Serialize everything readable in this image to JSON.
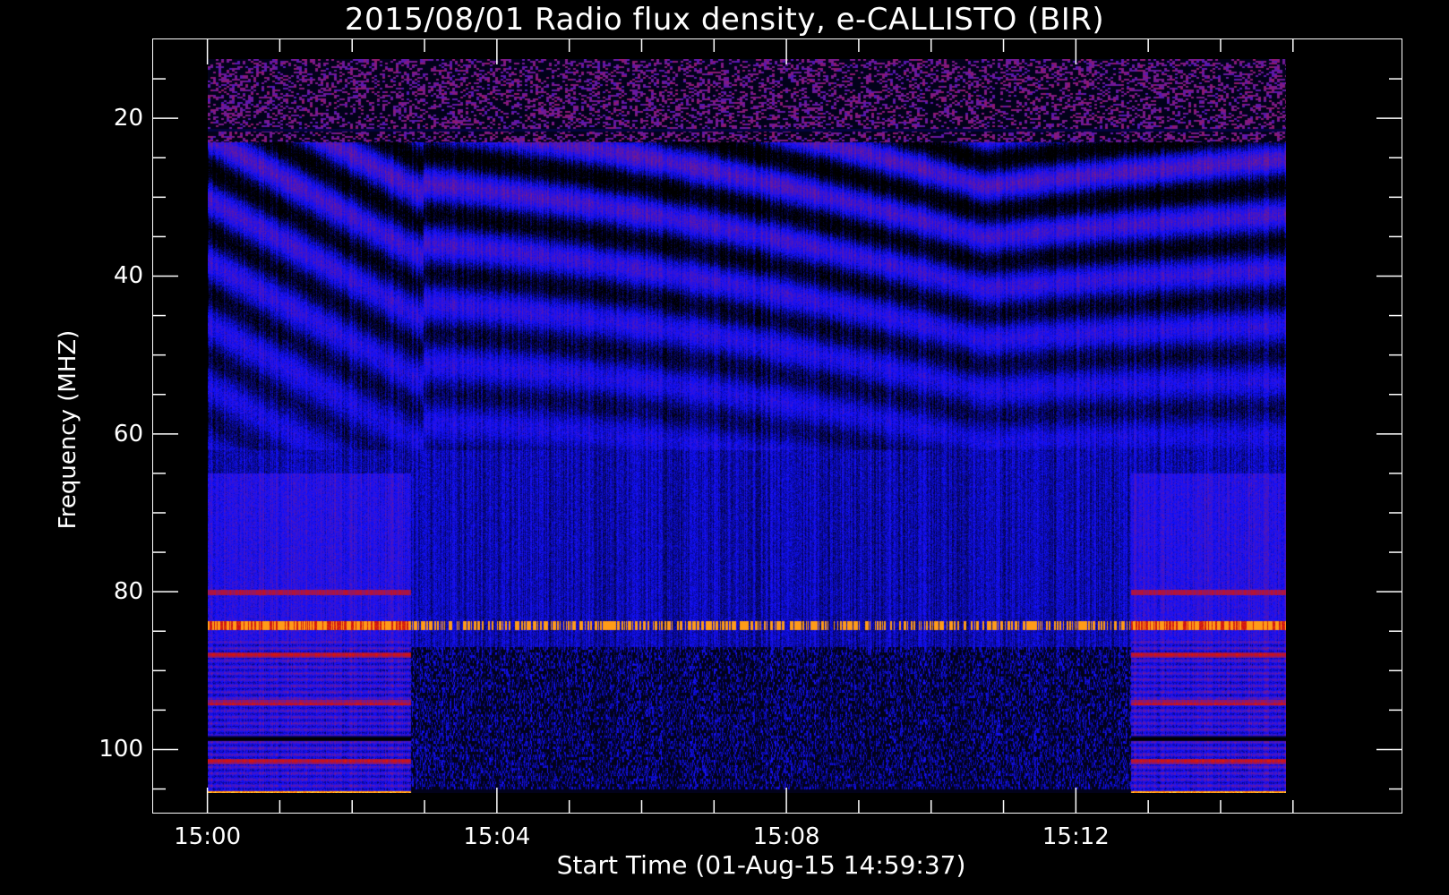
{
  "chart_data": {
    "type": "heatmap",
    "title": "2015/08/01  Radio flux density, e-CALLISTO (BIR)",
    "xlabel": "Start Time (01-Aug-15 14:59:37)",
    "ylabel": "Frequency (MHZ)",
    "x_range_minutes_after_1500": [
      -0.75,
      16.5
    ],
    "data_x_range_minutes_after_1500": [
      0,
      14.9
    ],
    "ylim": [
      10,
      108
    ],
    "y_inverted": true,
    "data_y_range": [
      12.5,
      105.5
    ],
    "x_ticks": [
      {
        "label": "15:00",
        "minute": 0
      },
      {
        "label": "15:04",
        "minute": 4
      },
      {
        "label": "15:08",
        "minute": 8
      },
      {
        "label": "15:12",
        "minute": 12
      }
    ],
    "y_ticks": [
      20,
      40,
      60,
      80,
      100
    ],
    "y_minor_step": 5,
    "x_minor_step_minutes": 1,
    "colormap": [
      "#000000",
      "#1010ff",
      "#7a1a8a",
      "#d01010",
      "#ff7a00",
      "#ffff60"
    ],
    "features": {
      "rfi_band_upper_MHz": [
        12,
        23
      ],
      "flat_segment_minutes": [
        2.8,
        12.75
      ],
      "narrowband_line_MHz": 84.2,
      "low_band_lines_MHz": [
        80,
        88,
        94,
        98.5,
        101.5,
        105.5
      ]
    }
  }
}
